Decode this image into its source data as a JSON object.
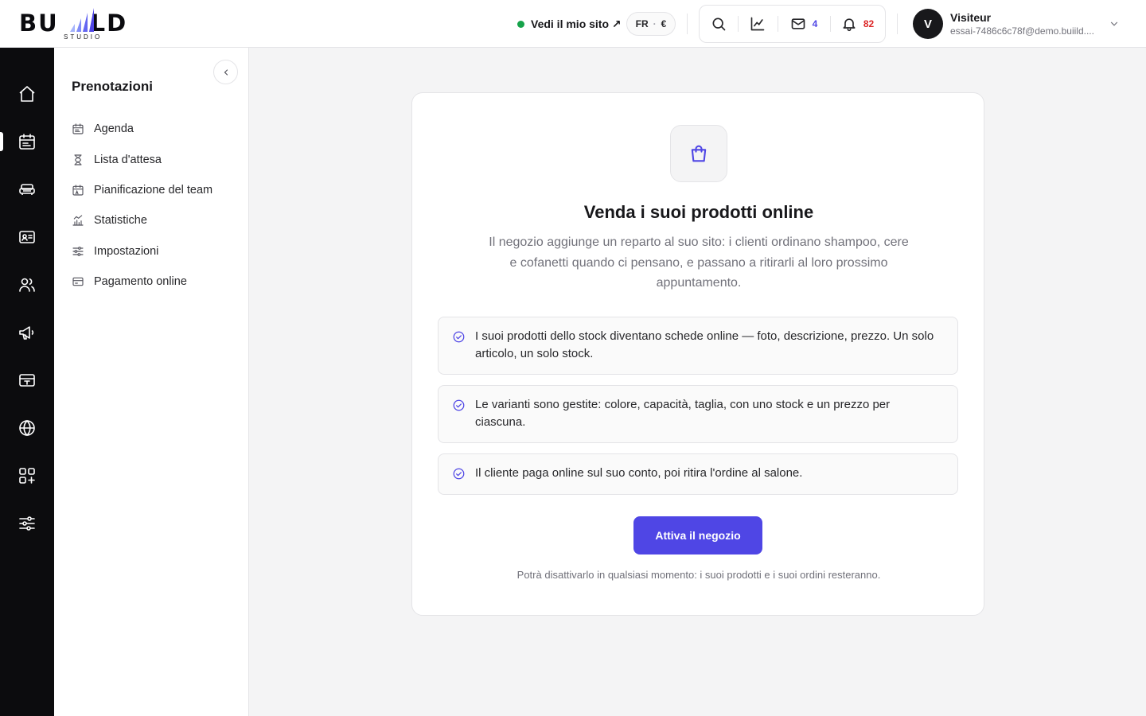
{
  "brand": {
    "wordmark_left": "BU",
    "wordmark_right": "LD",
    "subtitle": "STUDIO"
  },
  "header": {
    "site_link": "Vedi il mio sito ↗",
    "site_status_color": "#16a34a",
    "language": "FR",
    "currency": "€",
    "tools": [
      {
        "icon": "search-icon"
      },
      {
        "icon": "chart-line-icon"
      },
      {
        "icon": "mail-icon",
        "count": "4",
        "count_color": "#4f46e5"
      },
      {
        "icon": "bell-icon",
        "count": "82",
        "count_color": "#dc2626"
      }
    ],
    "user": {
      "initial": "V",
      "name": "Visiteur",
      "email": "essai-7486c6c78f@demo.buiild...."
    }
  },
  "rail": {
    "items": [
      "home-icon",
      "calendar-icon",
      "sofa-icon",
      "contact-card-icon",
      "users-icon",
      "megaphone-icon",
      "register-icon",
      "globe-icon",
      "apps-icon",
      "sliders-icon"
    ],
    "active": "calendar-icon"
  },
  "subnav": {
    "title": "Prenotazioni",
    "items": [
      {
        "label": "Agenda",
        "icon": "calendar-icon"
      },
      {
        "label": "Lista d'attesa",
        "icon": "hourglass-icon"
      },
      {
        "label": "Pianificazione del team",
        "icon": "calendar-user-icon"
      },
      {
        "label": "Statistiche",
        "icon": "chart-bar-icon"
      },
      {
        "label": "Impostazioni",
        "icon": "sliders-icon"
      },
      {
        "label": "Pagamento online",
        "icon": "credit-card-icon"
      }
    ]
  },
  "shop": {
    "icon": "shopping-bag-icon",
    "title": "Venda i suoi prodotti online",
    "description": "Il negozio aggiunge un reparto al suo sito: i clienti ordinano shampoo, cere e cofanetti quando ci pensano, e passano a ritirarli al loro prossimo appuntamento.",
    "features": [
      "I suoi prodotti dello stock diventano schede online — foto, descrizione, prezzo. Un solo articolo, un solo stock.",
      "Le varianti sono gestite: colore, capacità, taglia, con uno stock e un prezzo per ciascuna.",
      "Il cliente paga online sul suo conto, poi ritira l'ordine al salone."
    ],
    "cta_label": "Attiva il negozio",
    "footnote": "Potrà disattivarlo in qualsiasi momento: i suoi prodotti e i suoi ordini resteranno.",
    "accent_color": "#4f46e5"
  }
}
